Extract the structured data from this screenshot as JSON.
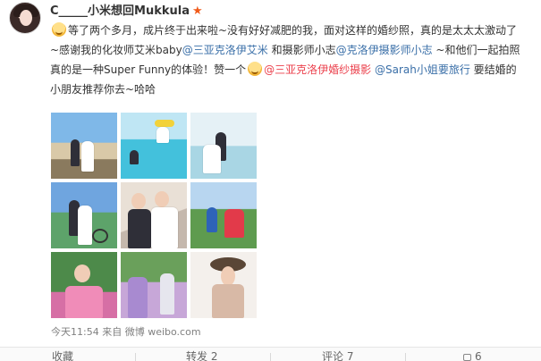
{
  "user": {
    "name": "C_____小米想回Mukkula",
    "badge_icon": "red-star-icon",
    "badge_glyph": "★"
  },
  "post": {
    "line1_a": "等了两个多月，成片终于出来啦~没有好好减肥的我，面对这样的婚纱照，真的是太太太激动了",
    "line2_a": "~感谢我的化妆师艾米baby",
    "mention_makeup": "@三亚克洛伊艾米",
    "line2_b": " 和摄影师小志",
    "mention_photographer": "@克洛伊摄影师小志",
    "line2_c": " ~和他们一起拍照",
    "line3_a": "真的是一种Super Funny的体验！赞一个",
    "mention_studio": "@三亚克洛伊婚纱摄影",
    "mention_sarah": "@Sarah小姐要旅行",
    "line3_b": " 要结婚的",
    "line4": "小朋友推荐你去~哈哈"
  },
  "photos": [
    {
      "id": 1,
      "icon": "wedding-photo-icon"
    },
    {
      "id": 2,
      "icon": "wedding-photo-icon"
    },
    {
      "id": 3,
      "icon": "wedding-photo-icon"
    },
    {
      "id": 4,
      "icon": "wedding-photo-icon"
    },
    {
      "id": 5,
      "icon": "wedding-photo-icon"
    },
    {
      "id": 6,
      "icon": "wedding-photo-icon"
    },
    {
      "id": 7,
      "icon": "wedding-photo-icon"
    },
    {
      "id": 8,
      "icon": "wedding-photo-icon"
    },
    {
      "id": 9,
      "icon": "wedding-photo-icon"
    }
  ],
  "meta": {
    "time": "今天11:54",
    "source_prefix": " 来自 ",
    "source_app": "微博 weibo.com"
  },
  "actions": {
    "collect": "收藏",
    "repost": "转发 2",
    "comment": "评论 7",
    "like": "6"
  },
  "colors": {
    "link": "#3a6fa8",
    "highlight": "#eb3f4b",
    "star": "#f05a1a"
  }
}
